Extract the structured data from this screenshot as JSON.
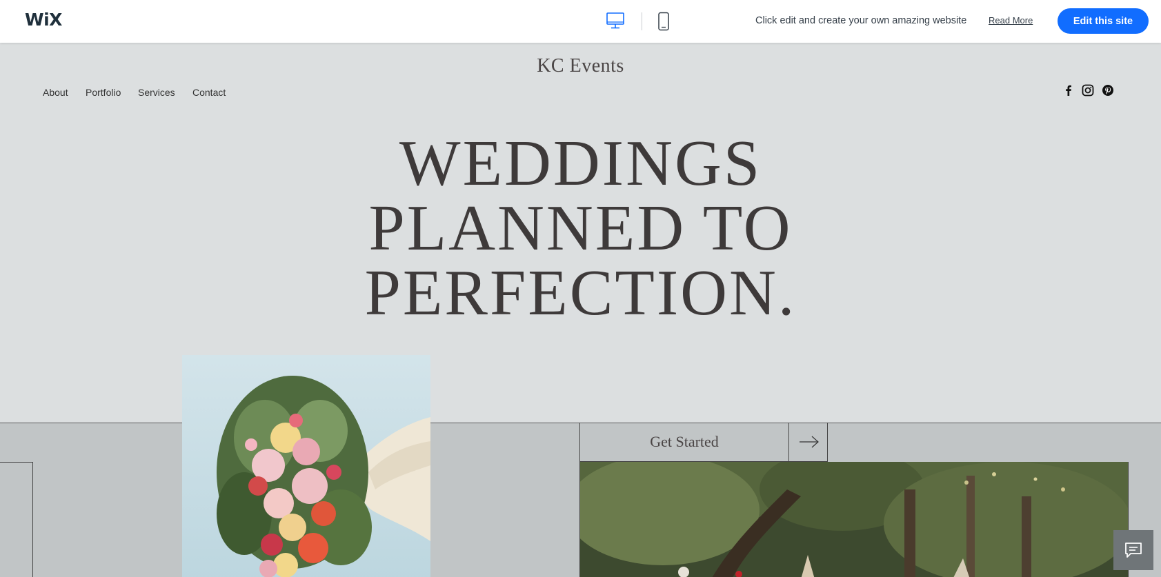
{
  "wixbar": {
    "logo": "WiX",
    "device_desktop_icon": "desktop-monitor-icon",
    "device_mobile_icon": "mobile-phone-icon",
    "promo_text": "Click edit and create your own amazing website",
    "read_more": "Read More",
    "edit_button": "Edit this site",
    "accent_color": "#116dff"
  },
  "site": {
    "title": "KC Events",
    "nav": [
      "About",
      "Portfolio",
      "Services",
      "Contact"
    ],
    "social_icons": [
      "facebook-icon",
      "instagram-icon",
      "pinterest-icon"
    ]
  },
  "hero": {
    "lines": [
      "WEDDINGS",
      "PLANNED TO",
      "PERFECTION."
    ]
  },
  "cta": {
    "label": "Get Started",
    "arrow_icon": "arrow-right-icon"
  },
  "chat": {
    "icon": "chat-bubble-icon"
  },
  "colors": {
    "page_bg": "#dcdfe0",
    "band_bg": "#c1c5c6",
    "hero_text": "#3e3a3a"
  }
}
